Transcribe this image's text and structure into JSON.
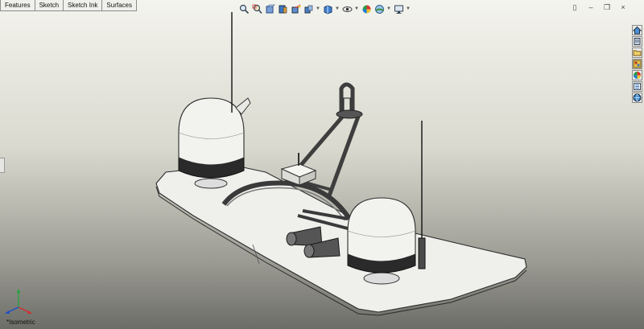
{
  "command_manager": {
    "tabs": [
      "Features",
      "Sketch",
      "Sketch Ink",
      "Surfaces"
    ]
  },
  "heads_up_toolbar": {
    "tools": [
      "zoom-to-fit-icon",
      "zoom-to-area-icon",
      "previous-view-icon",
      "section-view-icon",
      "dynamic-annotation-icon",
      "view-orientation-icon",
      "display-style-icon",
      "hide-show-items-icon",
      "edit-appearance-icon",
      "apply-scene-icon",
      "view-settings-icon"
    ]
  },
  "window_controls": {
    "icons": [
      "tile-icon",
      "minimize-icon",
      "restore-icon",
      "close-icon"
    ],
    "glyphs": [
      "▯",
      "–",
      "❐",
      "×"
    ]
  },
  "task_pane": {
    "icons": [
      "home-icon",
      "design-library-icon",
      "file-explorer-icon",
      "view-palette-icon",
      "appearances-icon",
      "custom-properties-icon",
      "solidworks-resources-icon"
    ]
  },
  "view": {
    "name": "*Isometric",
    "colors": {
      "background_top": "#f4f4ee",
      "background_bottom": "#6d6d68"
    }
  }
}
